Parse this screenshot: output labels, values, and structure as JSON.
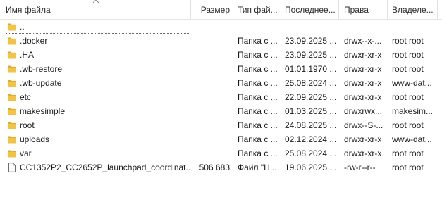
{
  "columns": {
    "name": "Имя файла",
    "size": "Размер",
    "type": "Тип фай...",
    "modified": "Последнее...",
    "permissions": "Права",
    "owner": "Владеле..."
  },
  "colors": {
    "folder": "#f3c443",
    "folder_dark": "#e0a928",
    "file_border": "#6d6d6d"
  },
  "rows": [
    {
      "icon": "folder-icon",
      "name": "..",
      "size": "",
      "type": "",
      "modified": "",
      "permissions": "",
      "owner": ""
    },
    {
      "icon": "folder-icon",
      "name": ".docker",
      "size": "",
      "type": "Папка с ...",
      "modified": "23.09.2025 ...",
      "permissions": "drwx--x-...",
      "owner": "root root"
    },
    {
      "icon": "folder-icon",
      "name": ".HA",
      "size": "",
      "type": "Папка с ...",
      "modified": "23.09.2025 ...",
      "permissions": "drwxr-xr-x",
      "owner": "root root"
    },
    {
      "icon": "folder-icon",
      "name": ".wb-restore",
      "size": "",
      "type": "Папка с ...",
      "modified": "01.01.1970 ...",
      "permissions": "drwxr-xr-x",
      "owner": "root root"
    },
    {
      "icon": "folder-icon",
      "name": ".wb-update",
      "size": "",
      "type": "Папка с ...",
      "modified": "25.08.2024 ...",
      "permissions": "drwxr-xr-x",
      "owner": "www-dat..."
    },
    {
      "icon": "folder-icon",
      "name": "etc",
      "size": "",
      "type": "Папка с ...",
      "modified": "22.09.2025 ...",
      "permissions": "drwxr-xr-x",
      "owner": "root root"
    },
    {
      "icon": "folder-icon",
      "name": "makesimple",
      "size": "",
      "type": "Папка с ...",
      "modified": "01.03.2025 ...",
      "permissions": "drwxrwx...",
      "owner": "makesim..."
    },
    {
      "icon": "folder-icon",
      "name": "root",
      "size": "",
      "type": "Папка с ...",
      "modified": "24.08.2025 ...",
      "permissions": "drwx--S-...",
      "owner": "root root"
    },
    {
      "icon": "folder-icon",
      "name": "uploads",
      "size": "",
      "type": "Папка с ...",
      "modified": "02.12.2024 ...",
      "permissions": "drwxr-xr-x",
      "owner": "www-dat..."
    },
    {
      "icon": "folder-icon",
      "name": "var",
      "size": "",
      "type": "Папка с ...",
      "modified": "25.08.2024 ...",
      "permissions": "drwxr-xr-x",
      "owner": "root root"
    },
    {
      "icon": "file-icon",
      "name": "CC1352P2_CC2652P_launchpad_coordinat...",
      "size": "506 683",
      "type": "Файл \"H...",
      "modified": "19.06.2025 ...",
      "permissions": "-rw-r--r--",
      "owner": "root root"
    }
  ]
}
